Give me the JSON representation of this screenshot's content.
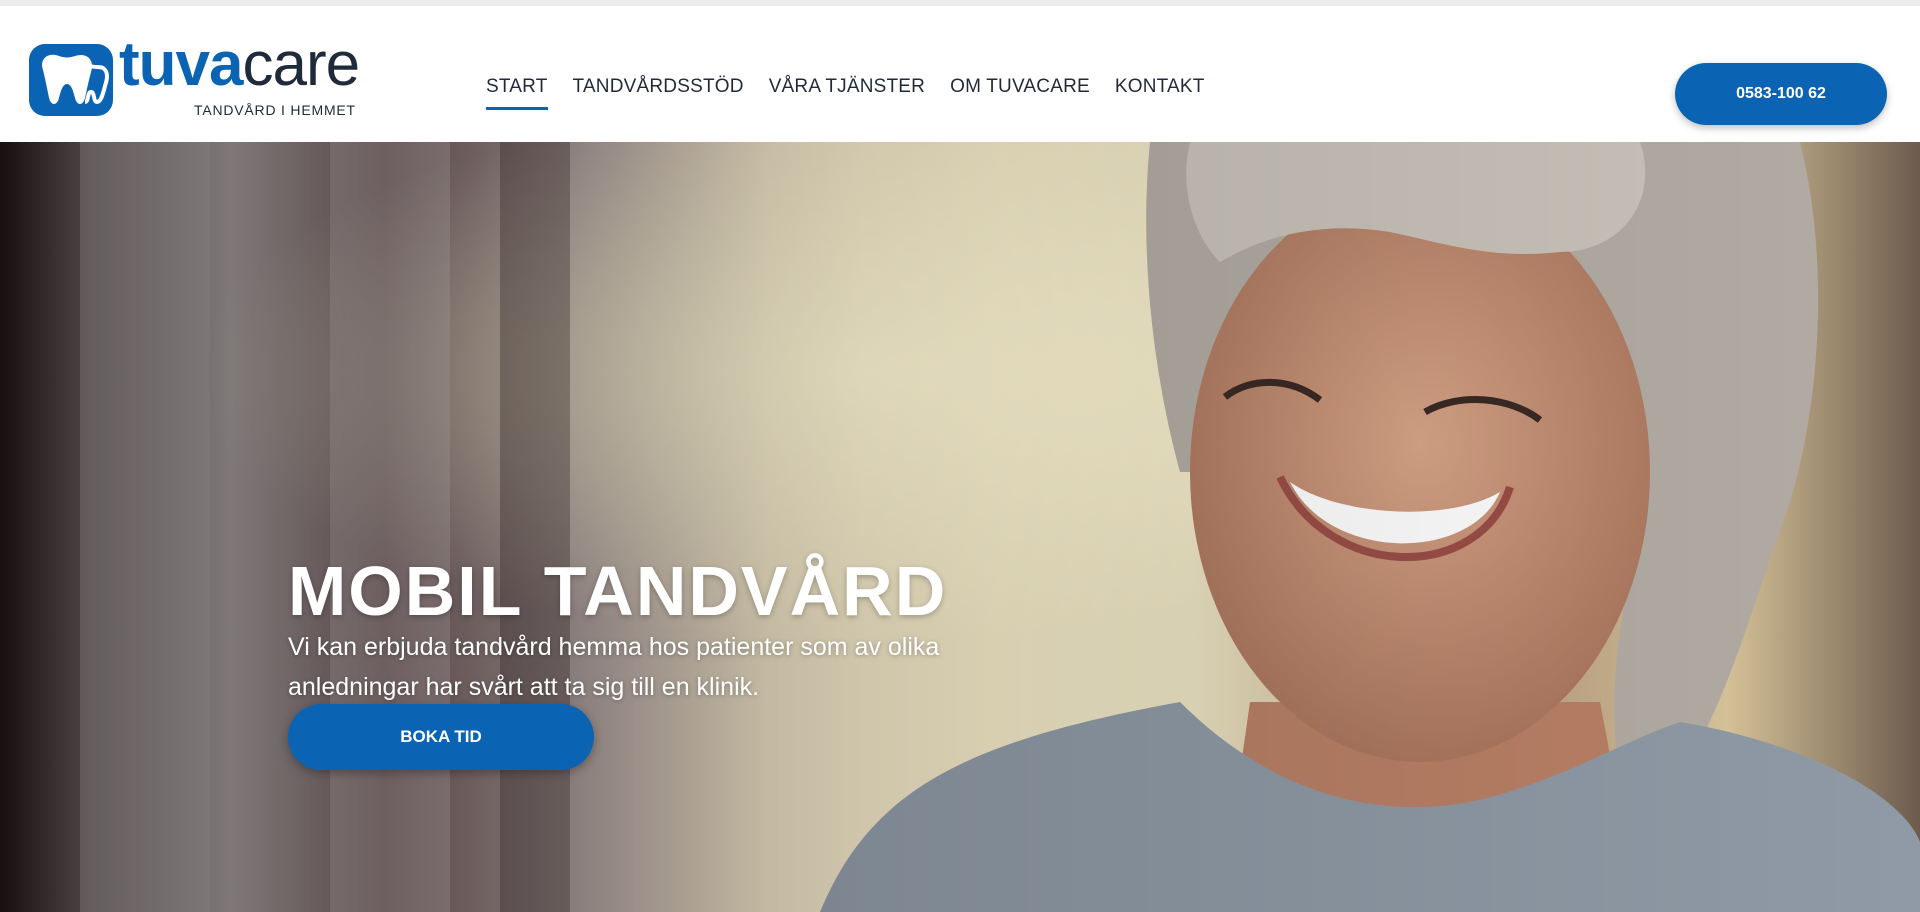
{
  "brand": {
    "name_part1": "tuva",
    "name_part2": "care",
    "tagline": "TANDVÅRD I HEMMET",
    "logo_icon": "tooth-icon",
    "colors": {
      "primary": "#0a64b3",
      "text": "#1f2b3a"
    }
  },
  "nav": {
    "items": [
      {
        "label": "START",
        "active": true
      },
      {
        "label": "TANDVÅRDSSTÖD",
        "active": false
      },
      {
        "label": "VÅRA TJÄNSTER",
        "active": false
      },
      {
        "label": "OM TUVACARE",
        "active": false
      },
      {
        "label": "KONTAKT",
        "active": false
      }
    ],
    "phone_label": "0583-100 62"
  },
  "hero": {
    "title": "MOBIL TANDVÅRD",
    "text": "Vi kan erbjuda tandvård hemma hos patienter som av olika anledningar har svårt att ta sig till en klinik.",
    "cta_label": "BOKA TID",
    "image": "smiling-woman-photo"
  }
}
